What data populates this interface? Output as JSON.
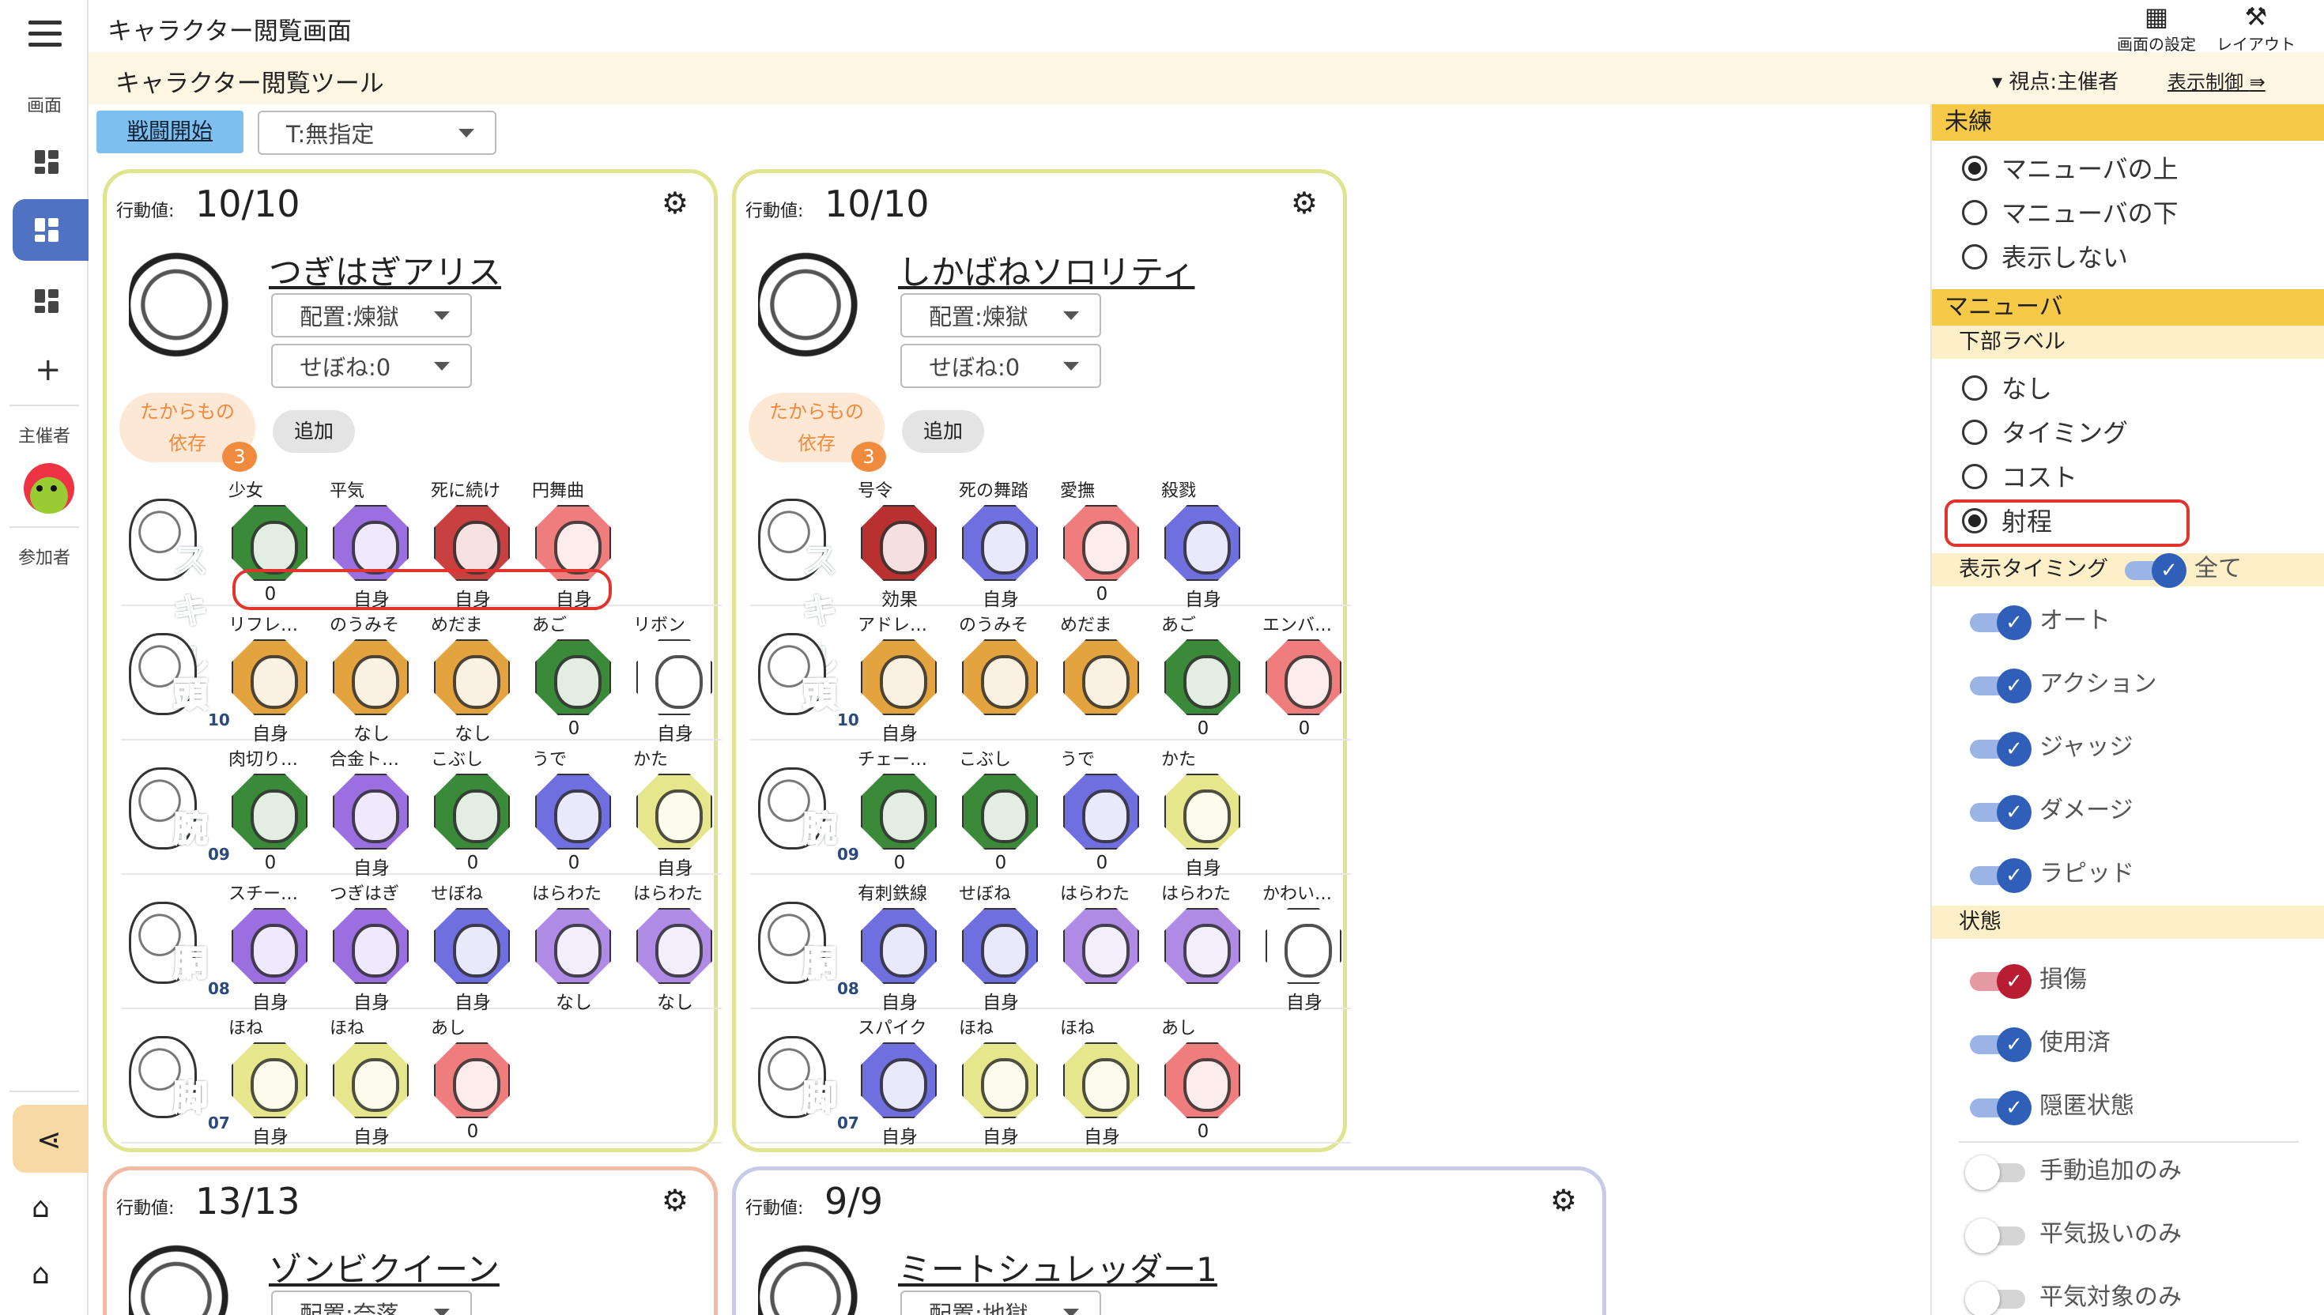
{
  "app": {
    "title": "キャラクター閲覧画面",
    "subtitle": "キャラクター閲覧ツール"
  },
  "top_actions": [
    {
      "label": "画面の設定",
      "icon": "grid-icon"
    },
    {
      "label": "レイアウト",
      "icon": "tools-icon"
    }
  ],
  "viewpoint": "▾ 視点:主催者",
  "display_control": "表示制御",
  "rail": {
    "section_screen": "画面",
    "section_host": "主催者",
    "section_participants": "参加者"
  },
  "toolbar": {
    "start_battle": "戦闘開始",
    "timing_select": "T:無指定"
  },
  "cards": [
    {
      "action_label": "行動値:",
      "action_value": "10/10",
      "name": "つぎはぎアリス",
      "placement": "配置:煉獄",
      "sebone": "せぼね:0",
      "treasure": [
        "たからもの",
        "依存"
      ],
      "treasure_count": "3",
      "add_label": "追加",
      "rows": [
        {
          "icon": "skill-icon",
          "label": "スキル",
          "num": "",
          "parts": [
            {
              "name": "少女",
              "value": "0",
              "color": "#3a8a3a"
            },
            {
              "name": "平気",
              "value": "自身",
              "color": "#9b6fe0"
            },
            {
              "name": "死に続け",
              "value": "自身",
              "color": "#c94040"
            },
            {
              "name": "円舞曲",
              "value": "自身",
              "color": "#ef7d7d"
            }
          ]
        },
        {
          "icon": "head-icon",
          "label": "頭",
          "num": "10",
          "parts": [
            {
              "name": "リフレ…",
              "value": "自身",
              "color": "#e3a43f"
            },
            {
              "name": "のうみそ",
              "value": "なし",
              "color": "#e3a43f"
            },
            {
              "name": "めだま",
              "value": "なし",
              "color": "#e3a43f"
            },
            {
              "name": "あご",
              "value": "0",
              "color": "#3a8a3a"
            },
            {
              "name": "リボン",
              "value": "自身",
              "color": "#ffffff"
            }
          ]
        },
        {
          "icon": "arm-icon",
          "label": "腕",
          "num": "09",
          "parts": [
            {
              "name": "肉切り…",
              "value": "0",
              "color": "#3a8a3a"
            },
            {
              "name": "合金ト…",
              "value": "自身",
              "color": "#9b6fe0"
            },
            {
              "name": "こぶし",
              "value": "0",
              "color": "#3a8a3a"
            },
            {
              "name": "うで",
              "value": "0",
              "color": "#6f6fe0"
            },
            {
              "name": "かた",
              "value": "自身",
              "color": "#e6e68c"
            }
          ]
        },
        {
          "icon": "torso-icon",
          "label": "胴",
          "num": "08",
          "parts": [
            {
              "name": "スチー…",
              "value": "自身",
              "color": "#9b6fe0"
            },
            {
              "name": "つぎはぎ",
              "value": "自身",
              "color": "#9b6fe0"
            },
            {
              "name": "せぼね",
              "value": "自身",
              "color": "#6f6fe0"
            },
            {
              "name": "はらわた",
              "value": "なし",
              "color": "#b08be6"
            },
            {
              "name": "はらわた",
              "value": "なし",
              "color": "#b08be6"
            }
          ]
        },
        {
          "icon": "leg-icon",
          "label": "脚",
          "num": "07",
          "parts": [
            {
              "name": "ほね",
              "value": "自身",
              "color": "#e6e68c"
            },
            {
              "name": "ほね",
              "value": "自身",
              "color": "#e6e68c"
            },
            {
              "name": "あし",
              "value": "0",
              "color": "#ef7d7d"
            }
          ]
        }
      ]
    },
    {
      "action_label": "行動値:",
      "action_value": "10/10",
      "name": "しかばねソロリティ",
      "placement": "配置:煉獄",
      "sebone": "せぼね:0",
      "treasure": [
        "たからもの",
        "依存"
      ],
      "treasure_count": "3",
      "add_label": "追加",
      "rows": [
        {
          "icon": "skill-icon",
          "label": "スキル",
          "num": "",
          "parts": [
            {
              "name": "号令",
              "value": "効果",
              "color": "#b83030"
            },
            {
              "name": "死の舞踏",
              "value": "自身",
              "color": "#6f6fe0"
            },
            {
              "name": "愛撫",
              "value": "0",
              "color": "#ef7d7d"
            },
            {
              "name": "殺戮",
              "value": "自身",
              "color": "#6f6fe0"
            }
          ]
        },
        {
          "icon": "head-icon",
          "label": "頭",
          "num": "10",
          "parts": [
            {
              "name": "アドレ…",
              "value": "自身",
              "color": "#e3a43f"
            },
            {
              "name": "のうみそ",
              "value": "",
              "color": "#e3a43f"
            },
            {
              "name": "めだま",
              "value": "",
              "color": "#e3a43f"
            },
            {
              "name": "あご",
              "value": "0",
              "color": "#3a8a3a"
            },
            {
              "name": "エンバ…",
              "value": "0",
              "color": "#ef7d7d"
            }
          ]
        },
        {
          "icon": "arm-icon",
          "label": "腕",
          "num": "09",
          "parts": [
            {
              "name": "チェー…",
              "value": "0",
              "color": "#3a8a3a"
            },
            {
              "name": "こぶし",
              "value": "0",
              "color": "#3a8a3a"
            },
            {
              "name": "うで",
              "value": "0",
              "color": "#6f6fe0"
            },
            {
              "name": "かた",
              "value": "自身",
              "color": "#e6e68c"
            }
          ]
        },
        {
          "icon": "torso-icon",
          "label": "胴",
          "num": "08",
          "parts": [
            {
              "name": "有刺鉄線",
              "value": "自身",
              "color": "#6f6fe0"
            },
            {
              "name": "せぼね",
              "value": "自身",
              "color": "#6f6fe0"
            },
            {
              "name": "はらわた",
              "value": "",
              "color": "#b08be6"
            },
            {
              "name": "はらわた",
              "value": "",
              "color": "#b08be6"
            },
            {
              "name": "かわい…",
              "value": "自身",
              "color": "#ffffff"
            }
          ]
        },
        {
          "icon": "leg-icon",
          "label": "脚",
          "num": "07",
          "parts": [
            {
              "name": "スパイク",
              "value": "自身",
              "color": "#6f6fe0"
            },
            {
              "name": "ほね",
              "value": "自身",
              "color": "#e6e68c"
            },
            {
              "name": "ほね",
              "value": "自身",
              "color": "#e6e68c"
            },
            {
              "name": "あし",
              "value": "0",
              "color": "#ef7d7d"
            }
          ]
        }
      ]
    }
  ],
  "lower_cards": [
    {
      "action_label": "行動値:",
      "action_value": "13/13",
      "name": "ゾンビクイーン",
      "placement": "配置:奈落",
      "border": "#f2b9a3"
    },
    {
      "action_label": "行動値:",
      "action_value": "9/9",
      "name": "ミートシュレッダー1",
      "placement": "配置:地獄",
      "border": "#c9c9ea"
    }
  ],
  "panel": {
    "unused_header": "未練",
    "unused_options": [
      {
        "label": "マニューバの上",
        "selected": true
      },
      {
        "label": "マニューバの下",
        "selected": false
      },
      {
        "label": "表示しない",
        "selected": false
      }
    ],
    "maneuver_header": "マニューバ",
    "bottom_label_header": "下部ラベル",
    "bottom_label_options": [
      {
        "label": "なし",
        "selected": false
      },
      {
        "label": "タイミング",
        "selected": false
      },
      {
        "label": "コスト",
        "selected": false
      },
      {
        "label": "射程",
        "selected": true
      }
    ],
    "timing_header": "表示タイミング",
    "timing_all": "全て",
    "timing_toggles": [
      "オート",
      "アクション",
      "ジャッジ",
      "ダメージ",
      "ラピッド"
    ],
    "state_header": "状態",
    "state_toggles": [
      {
        "label": "損傷",
        "on": true,
        "color": "red"
      },
      {
        "label": "使用済",
        "on": true,
        "color": "blue"
      },
      {
        "label": "隠匿状態",
        "on": true,
        "color": "blue"
      },
      {
        "label": "手動追加のみ",
        "on": false,
        "color": "gray"
      },
      {
        "label": "平気扱いのみ",
        "on": false,
        "color": "gray"
      },
      {
        "label": "平気対象のみ",
        "on": false,
        "color": "gray"
      }
    ]
  }
}
